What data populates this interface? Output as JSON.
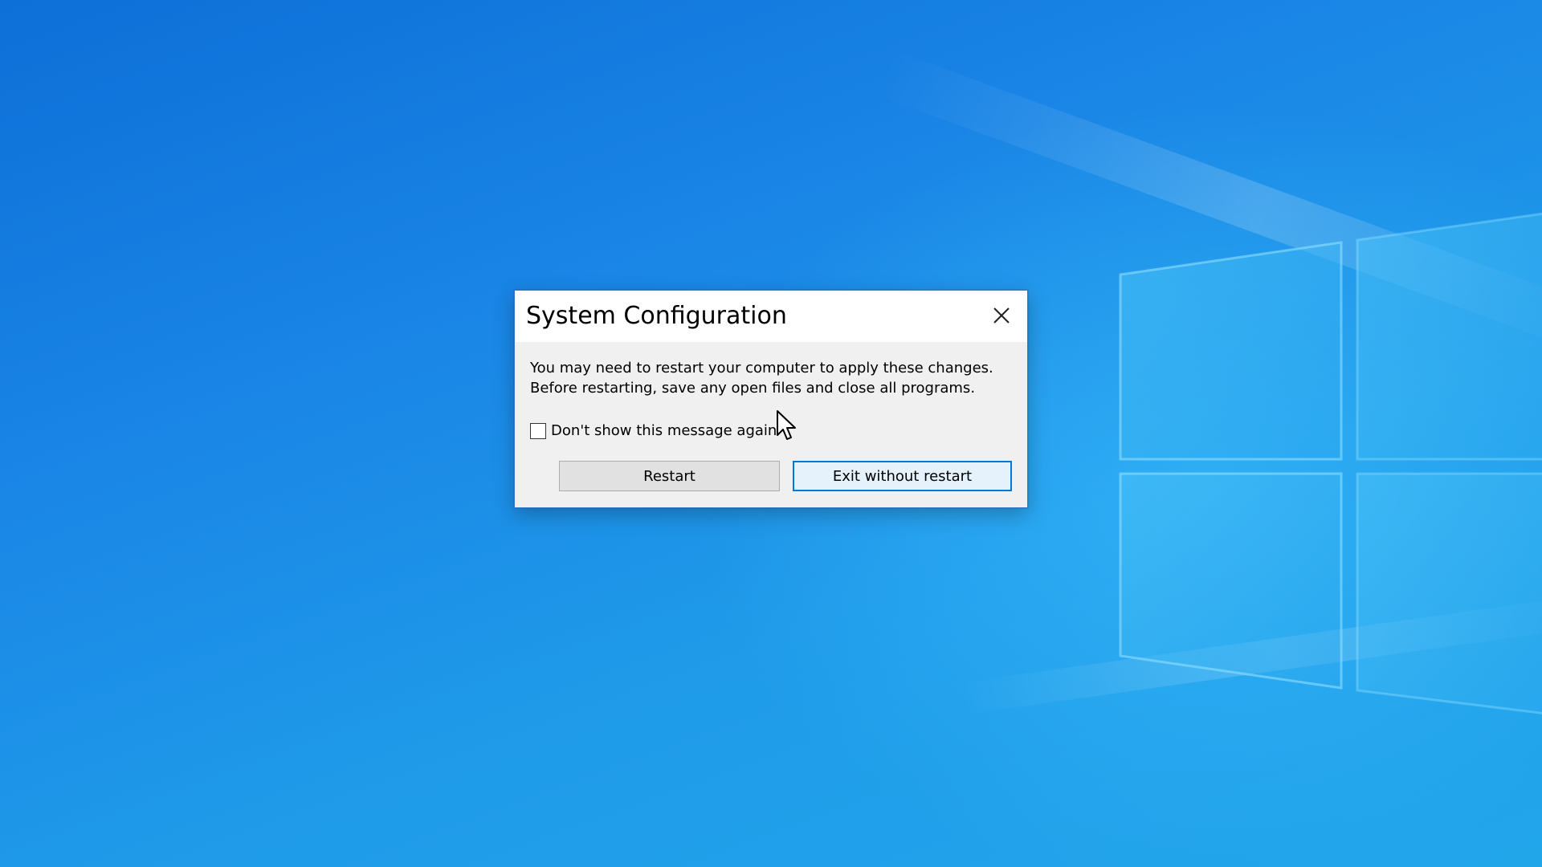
{
  "desktop": {
    "wallpaper": "windows-10-hero",
    "colors": {
      "background": "#1a86e6",
      "logo": "#3fb6f2"
    }
  },
  "dialog": {
    "title": "System Configuration",
    "close_icon": "close-icon",
    "message_lines": [
      "You may need to restart your computer to apply these changes.",
      "Before restarting, save any open files and close all programs."
    ],
    "checkbox": {
      "label": "Don't show this message again",
      "checked": false
    },
    "buttons": {
      "restart_label": "Restart",
      "exit_label": "Exit without restart"
    },
    "colors": {
      "accent": "#0078d7",
      "body": "#f0f0f0"
    }
  },
  "cursor": {
    "icon": "mouse-pointer-icon"
  }
}
